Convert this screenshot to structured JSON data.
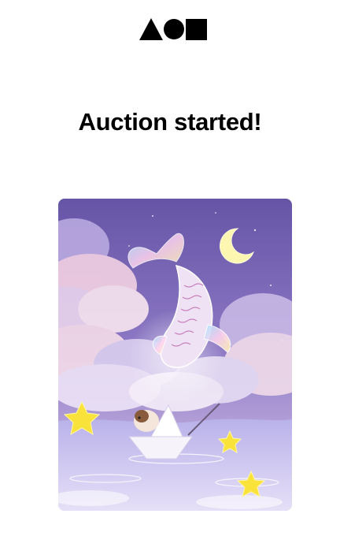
{
  "brand": {
    "logo_icon": "triangle-circle-square-logo-icon",
    "color": "#000000"
  },
  "heading": {
    "title": "Auction started!"
  },
  "artwork": {
    "icon": "koi-fish-night-sky-illustration",
    "colors": {
      "sky_top": "#6a5aa8",
      "sky_mid": "#8c78c4",
      "cloud": "#f3d9e6",
      "water": "#c7c3ee",
      "star": "#f9e33b",
      "moon": "#fdf6b0"
    }
  }
}
